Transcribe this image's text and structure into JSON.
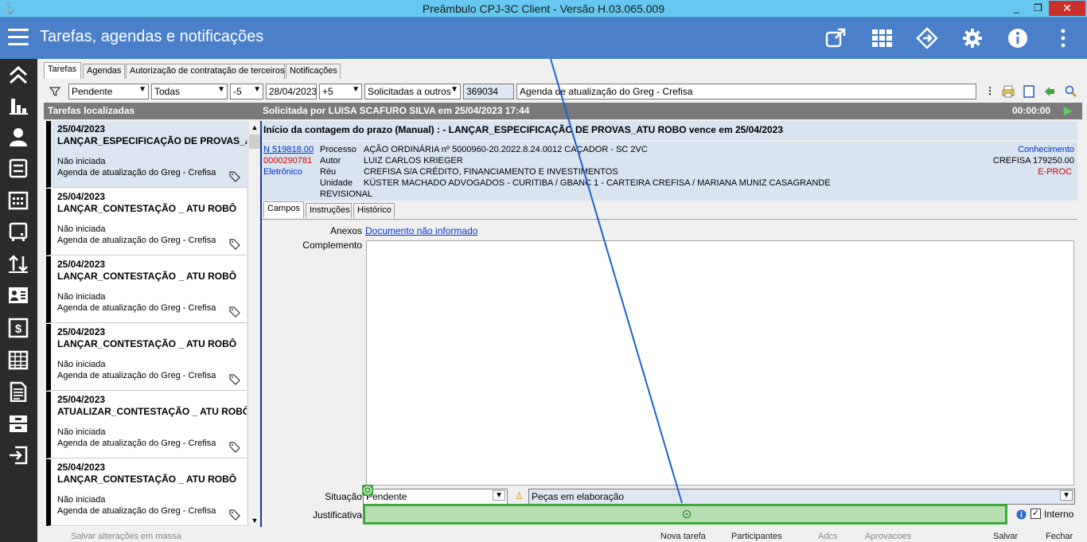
{
  "window": {
    "title": "Preâmbulo CPJ-3C Client - Versão H.03.065.009",
    "controls": [
      "_",
      "❐",
      "✕"
    ]
  },
  "appbar": {
    "title": "Tarefas, agendas e notificações",
    "icons": [
      "external-link-icon",
      "grid-icon",
      "diamond-arrows-icon",
      "gear-icon",
      "info-icon",
      "more-vertical-icon"
    ]
  },
  "sidebar": {
    "icons": [
      "chevrons-up-icon",
      "bar-chart-icon",
      "person-icon",
      "inbox-icon",
      "calendar-icon",
      "monitor-icon",
      "sort-icon",
      "contact-card-icon",
      "dollar-icon",
      "table-icon",
      "document-icon",
      "tray-icon",
      "sign-out-icon"
    ]
  },
  "tabs": [
    {
      "label": "Tarefas",
      "active": true
    },
    {
      "label": "Agendas",
      "active": false
    },
    {
      "label": "Autorização de contratação de terceiros",
      "active": false
    },
    {
      "label": "Notificações",
      "active": false
    }
  ],
  "filters": {
    "status": "Pendente",
    "scope": "Todas",
    "offset_before": "-5",
    "date": "28/04/2023",
    "offset_after": "+5",
    "requested": "Solicitadas a outros",
    "code": "369034",
    "agenda": "Agenda de atualização do Greg - Crefisa"
  },
  "list_header": {
    "left": "Tarefas localizadas",
    "center": "Solicitada por LUISA SCAFURO  SILVA em 25/04/2023 17:44",
    "timer": "00:00:00"
  },
  "tasks": [
    {
      "date": "25/04/2023",
      "title": "LANÇAR_ESPECIFICAÇÃO DE PROVAS_ATU",
      "status": "Não iniciada",
      "agenda": "Agenda de atualização do Greg - Crefisa",
      "active": true
    },
    {
      "date": "25/04/2023",
      "title": "LANÇAR_CONTESTAÇÃO _ ATU ROBÔ",
      "status": "Não iniciada",
      "agenda": "Agenda de atualização do Greg - Crefisa",
      "active": false
    },
    {
      "date": "25/04/2023",
      "title": "LANÇAR_CONTESTAÇÃO _ ATU ROBÔ",
      "status": "Não iniciada",
      "agenda": "Agenda de atualização do Greg - Crefisa",
      "active": false
    },
    {
      "date": "25/04/2023",
      "title": "LANÇAR_CONTESTAÇÃO _ ATU ROBÔ",
      "status": "Não iniciada",
      "agenda": "Agenda de atualização do Greg - Crefisa",
      "active": false
    },
    {
      "date": "25/04/2023",
      "title": "ATUALIZAR_CONTESTAÇÃO _ ATU ROBÔ",
      "status": "Não iniciada",
      "agenda": "Agenda de atualização do Greg - Crefisa",
      "active": false
    },
    {
      "date": "25/04/2023",
      "title": "LANÇAR_CONTESTAÇÃO _ ATU ROBÔ",
      "status": "Não iniciada",
      "agenda": "Agenda de atualização do Greg - Crefisa",
      "active": false
    }
  ],
  "detail": {
    "heading": "Início da contagem do prazo (Manual) :  - LANÇAR_ESPECIFICAÇÃO DE PROVAS_ATU ROBO vence em 25/04/2023",
    "link_number": "N 519818.00",
    "red_number": "0000290781",
    "eletronico": "Eletrônico",
    "processo_label": "Processo",
    "processo_value": "AÇÃO ORDINÁRIA  nº 5000960-20.2022.8.24.0012  CAÇADOR - SC  2VC",
    "autor_label": "Autor",
    "autor_value": "LUIZ CARLOS KRIEGER",
    "reu_label": "Réu",
    "reu_value": "CREFISA S/A CRÉDITO, FINANCIAMENTO E INVESTIMENTOS",
    "unidade_label": "Unidade",
    "unidade_value": "KÜSTER MACHADO ADVOGADOS - CURITIBA / GBANC 1  - CARTEIRA CREFISA / MARIANA MUNIZ CASAGRANDE",
    "revisional": "REVISIONAL",
    "conhecimento": "Conhecimento",
    "crefisa": "CREFISA 179250.00",
    "eproc": "E-PROC",
    "subtabs": [
      "Campos",
      "Instruções",
      "Histórico"
    ],
    "anexos_label": "Anexos",
    "anexos_value": "Documento não informado",
    "complemento_label": "Complemento",
    "situacao_label": "Situação",
    "situacao_value": "Pendente",
    "situacao_detail": "Peças em elaboração",
    "justificativa_label": "Justificativa",
    "interno_label": "Interno"
  },
  "bottom": {
    "save_hint": "Salvar alterações em massa",
    "new_task": "Nova tarefa",
    "participants": "Participantes",
    "add": "Adcs",
    "approve": "Aprovacoes",
    "save": "Salvar",
    "close": "Fechar"
  }
}
